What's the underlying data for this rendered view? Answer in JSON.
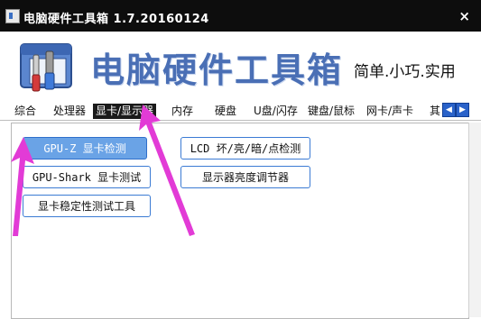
{
  "window": {
    "title": "电脑硬件工具箱 1.7.20160124",
    "close_glyph": "×"
  },
  "header": {
    "brand": "电脑硬件工具箱",
    "slogan": "简单.小巧.实用"
  },
  "tabs": [
    {
      "label": "综合"
    },
    {
      "label": "处理器"
    },
    {
      "label": "显卡/显示器",
      "active": true
    },
    {
      "label": "内存"
    },
    {
      "label": "硬盘"
    },
    {
      "label": "U盘/闪存"
    },
    {
      "label": "键盘/鼠标"
    },
    {
      "label": "网卡/声卡"
    },
    {
      "label": "其"
    }
  ],
  "tab_arrows": {
    "left": "◀",
    "right": "▶"
  },
  "tools": [
    {
      "label": "GPU-Z 显卡检测",
      "highlighted": true
    },
    {
      "label": "GPU-Shark 显卡测试"
    },
    {
      "label": "显卡稳定性测试工具"
    },
    {
      "label": "LCD 坏/亮/暗/点检测"
    },
    {
      "label": "显示器亮度调节器"
    }
  ],
  "colors": {
    "titlebar": "#0d0d0d",
    "brand": "#4a6fb5",
    "button_border": "#3b7bd4",
    "button_highlight": "#6aa3e6",
    "annotation_arrow": "#e23bd6"
  }
}
